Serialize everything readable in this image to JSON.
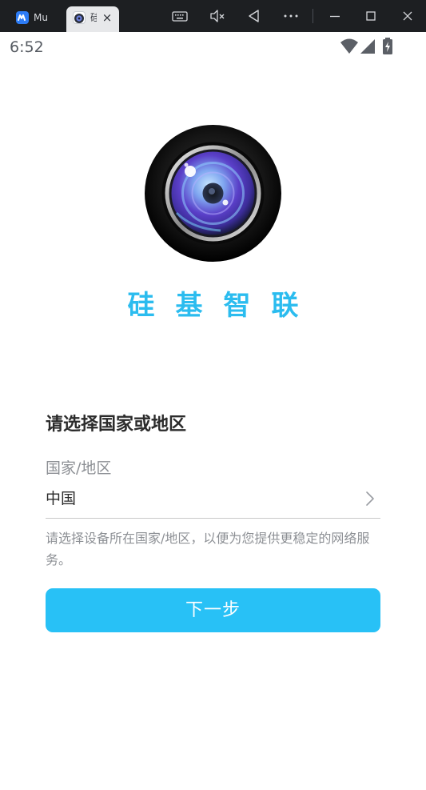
{
  "emulator": {
    "tabs": [
      {
        "label": "Mu",
        "icon": "mumu-logo-icon",
        "active": false
      },
      {
        "label": "硅",
        "icon": "camera-app-icon",
        "active": true,
        "close_glyph": "×"
      }
    ],
    "toolbar_icons": [
      "keyboard-icon",
      "mute-icon",
      "back-icon",
      "more-icon",
      "minimize-icon",
      "maximize-icon",
      "close-icon"
    ],
    "colors": {
      "bar_bg": "#1d1f22",
      "active_tab_bg": "#e7e8ea"
    }
  },
  "status_bar": {
    "time": "6:52",
    "icons": [
      "wifi-icon",
      "cellular-signal-icon",
      "battery-charging-icon"
    ]
  },
  "app": {
    "logo": "camera-lens-logo",
    "name": "硅基智联",
    "colors": {
      "brand": "#2bbcef",
      "button": "#28c1f6"
    }
  },
  "region_form": {
    "title": "请选择国家或地区",
    "field_label": "国家/地区",
    "selected_country": "中国",
    "hint": "请选择设备所在国家/地区，以便为您提供更稳定的网络服务。",
    "next_button": "下一步"
  }
}
